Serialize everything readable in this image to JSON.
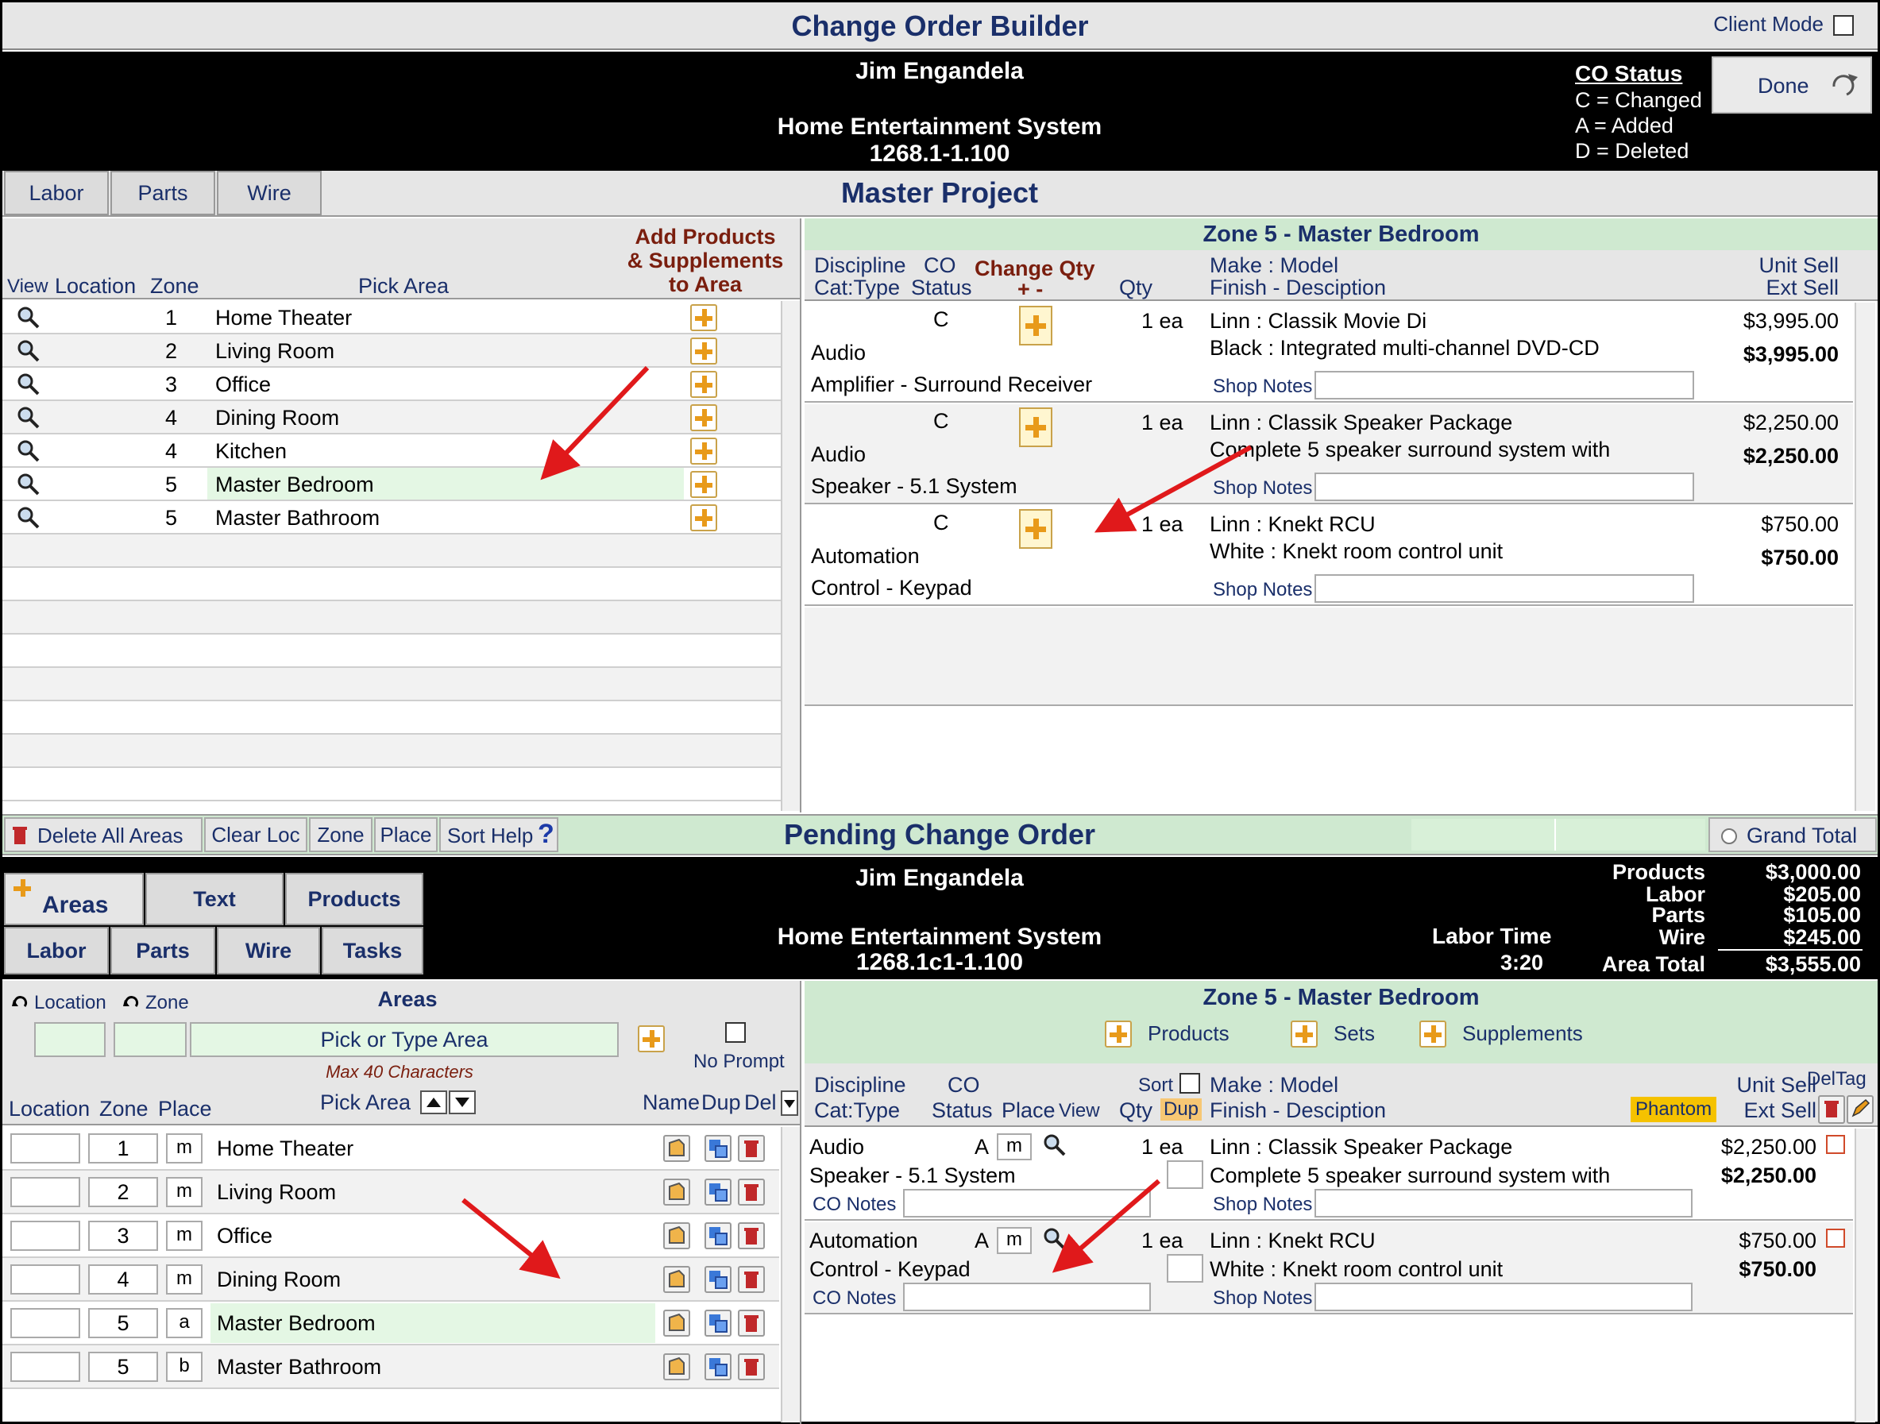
{
  "window": {
    "title": "Change Order Builder",
    "client_mode_label": "Client Mode"
  },
  "top": {
    "customer": "Jim Engandela",
    "project": "Home Entertainment System",
    "project_num": "1268.1-1.100",
    "co_status": {
      "title": "CO Status",
      "c": "C = Changed",
      "a": "A = Added",
      "d": "D = Deleted"
    },
    "done_label": "Done",
    "tabs": [
      "Labor",
      "Parts",
      "Wire"
    ],
    "section_title": "Master Project"
  },
  "areas_top": {
    "headers": {
      "view": "View",
      "location": "Location",
      "zone": "Zone",
      "pick_area": "Pick Area",
      "add1": "Add Products",
      "add2": "& Supplements",
      "add3": "to Area"
    },
    "rows": [
      {
        "zone": "1",
        "area": "Home Theater"
      },
      {
        "zone": "2",
        "area": "Living Room"
      },
      {
        "zone": "3",
        "area": "Office"
      },
      {
        "zone": "4",
        "area": "Dining Room"
      },
      {
        "zone": "4",
        "area": "Kitchen"
      },
      {
        "zone": "5",
        "area": "Master Bedroom"
      },
      {
        "zone": "5",
        "area": "Master Bathroom"
      }
    ]
  },
  "products_top": {
    "zone_title": "Zone 5 - Master Bedroom",
    "headers": {
      "discipline": "Discipline",
      "cattype": "Cat:Type",
      "co": "CO",
      "status": "Status",
      "change_qty": "Change Qty",
      "plusminus": "+  -",
      "qty": "Qty",
      "make": "Make : Model",
      "finish": "Finish - Desciption",
      "unit": "Unit Sell",
      "ext": "Ext Sell"
    },
    "shop_notes_label": "Shop Notes",
    "items": [
      {
        "status": "C",
        "discipline": "Audio",
        "cattype": "Amplifier - Surround Receiver",
        "qty": "1 ea",
        "make": "Linn : Classik Movie Di",
        "finish": "Black : Integrated multi-channel DVD-CD",
        "unit": "$3,995.00",
        "ext": "$3,995.00"
      },
      {
        "status": "C",
        "discipline": "Audio",
        "cattype": "Speaker - 5.1 System",
        "qty": "1 ea",
        "make": "Linn : Classik Speaker Package",
        "finish": "Complete 5 speaker surround system with",
        "unit": "$2,250.00",
        "ext": "$2,250.00"
      },
      {
        "status": "C",
        "discipline": "Automation",
        "cattype": "Control - Keypad",
        "qty": "1 ea",
        "make": "Linn : Knekt RCU",
        "finish": "White : Knekt room control unit",
        "unit": "$750.00",
        "ext": "$750.00"
      }
    ]
  },
  "toolbar": {
    "delete_all": "Delete All Areas",
    "clear_loc": "Clear Loc",
    "zone": "Zone",
    "place": "Place",
    "sort_help": "Sort Help",
    "help_q": "?",
    "pending_title": "Pending Change Order",
    "grand_total": "Grand Total"
  },
  "bottom": {
    "customer": "Jim Engandela",
    "project": "Home Entertainment System",
    "project_num": "1268.1c1-1.100",
    "tabs1": [
      "Areas",
      "Text",
      "Products"
    ],
    "tabs2": [
      "Labor",
      "Parts",
      "Wire",
      "Tasks"
    ],
    "labor_time_label": "Labor Time",
    "labor_time": "3:20",
    "totals": [
      {
        "label": "Products",
        "value": "$3,000.00"
      },
      {
        "label": "Labor",
        "value": "$205.00"
      },
      {
        "label": "Parts",
        "value": "$105.00"
      },
      {
        "label": "Wire",
        "value": "$245.00"
      },
      {
        "label": "Area Total",
        "value": "$3,555.00"
      }
    ]
  },
  "areas_bottom": {
    "location_label": "Location",
    "zone_label": "Zone",
    "areas_title": "Areas",
    "pick_placeholder": "Pick or Type Area",
    "max_chars": "Max 40 Characters",
    "no_prompt": "No Prompt",
    "headers": {
      "location": "Location",
      "zone": "Zone",
      "place": "Place",
      "pick_area": "Pick Area",
      "name": "Name",
      "dup": "Dup",
      "del": "Del"
    },
    "rows": [
      {
        "zone": "1",
        "place": "m",
        "area": "Home Theater"
      },
      {
        "zone": "2",
        "place": "m",
        "area": "Living Room"
      },
      {
        "zone": "3",
        "place": "m",
        "area": "Office"
      },
      {
        "zone": "4",
        "place": "m",
        "area": "Dining Room"
      },
      {
        "zone": "5",
        "place": "a",
        "area": "Master Bedroom"
      },
      {
        "zone": "5",
        "place": "b",
        "area": "Master Bathroom"
      }
    ]
  },
  "products_bottom": {
    "zone_title": "Zone 5 - Master Bedroom",
    "buttons": {
      "products": "Products",
      "sets": "Sets",
      "supplements": "Supplements"
    },
    "headers": {
      "discipline": "Discipline",
      "cattype": "Cat:Type",
      "co": "CO",
      "status": "Status",
      "place": "Place",
      "view": "View",
      "sort": "Sort",
      "qty": "Qty",
      "dup": "Dup",
      "make": "Make : Model",
      "finish": "Finish - Desciption",
      "phantom": "Phantom",
      "unit": "Unit Sell",
      "ext": "Ext Sell",
      "deltag": "DelTag"
    },
    "co_notes_label": "CO Notes",
    "shop_notes_label": "Shop Notes",
    "items": [
      {
        "discipline": "Audio",
        "cattype": "Speaker - 5.1 System",
        "status": "A",
        "place": "m",
        "qty": "1 ea",
        "make": "Linn : Classik Speaker Package",
        "finish": "Complete 5 speaker surround system with",
        "unit": "$2,250.00",
        "ext": "$2,250.00"
      },
      {
        "discipline": "Automation",
        "cattype": "Control - Keypad",
        "status": "A",
        "place": "m",
        "qty": "1 ea",
        "make": "Linn : Knekt RCU",
        "finish": "White : Knekt room control unit",
        "unit": "$750.00",
        "ext": "$750.00"
      }
    ]
  },
  "colors": {
    "title_blue": "#1a2f6a",
    "header_green": "#cfe9d0",
    "highlight_green": "#e4f7e4",
    "arrow_red": "#e0191b",
    "plus_orange": "#e89a1a",
    "phantom_yellow": "#f5c200"
  }
}
